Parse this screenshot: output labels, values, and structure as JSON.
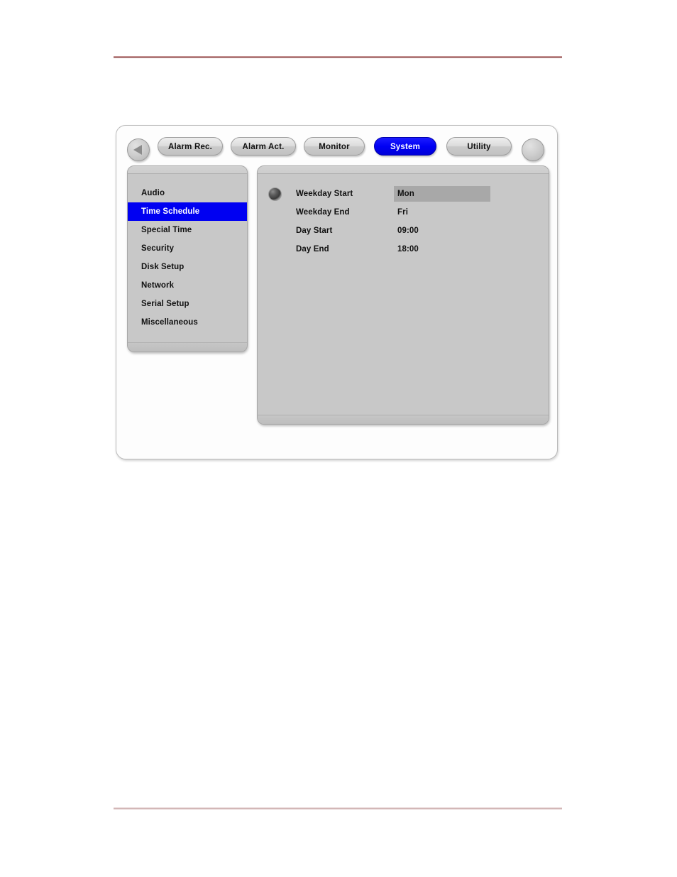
{
  "page": {
    "rule_color_top": "#7d3b3b",
    "rule_color_bottom": "#d8bcbc"
  },
  "device": {
    "accent_blue": "#0000f2",
    "panel_gray": "#c8c8c8",
    "nav": {
      "back_icon": "triangle-left-icon",
      "forward_icon": "circle-blank-icon"
    },
    "tabs": [
      {
        "label": "Alarm Rec.",
        "active": false
      },
      {
        "label": "Alarm Act.",
        "active": false
      },
      {
        "label": "Monitor",
        "active": false
      },
      {
        "label": "System",
        "active": true
      },
      {
        "label": "Utility",
        "active": false
      }
    ],
    "sidebar": {
      "items": [
        {
          "label": "Audio",
          "selected": false
        },
        {
          "label": "Time Schedule",
          "selected": true
        },
        {
          "label": "Special Time",
          "selected": false
        },
        {
          "label": "Security",
          "selected": false
        },
        {
          "label": "Disk Setup",
          "selected": false
        },
        {
          "label": "Network",
          "selected": false
        },
        {
          "label": "Serial Setup",
          "selected": false
        },
        {
          "label": "Miscellaneous",
          "selected": false
        }
      ]
    },
    "content": {
      "cursor_icon": "sphere-indicator-icon",
      "fields": [
        {
          "label": "Weekday Start",
          "value": "Mon",
          "highlighted": true
        },
        {
          "label": "Weekday End",
          "value": "Fri",
          "highlighted": false
        },
        {
          "label": "Day Start",
          "value": "09:00",
          "highlighted": false
        },
        {
          "label": "Day End",
          "value": "18:00",
          "highlighted": false
        }
      ]
    }
  }
}
